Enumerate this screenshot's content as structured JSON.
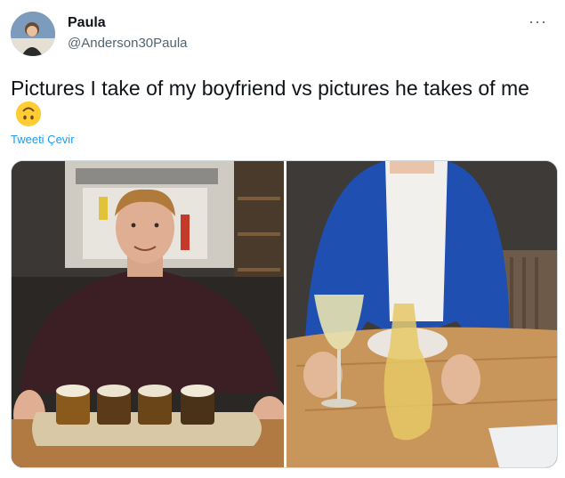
{
  "author": {
    "name": "Paula",
    "handle": "@Anderson30Paula"
  },
  "tweet": {
    "text": "Pictures I take of my boyfriend vs pictures he takes of me",
    "emoji_icon": "upside-down-face-emoji",
    "translate_label": "Tweeti Çevir"
  },
  "menu": {
    "more_label": "···"
  },
  "media": {
    "left_image": "man-with-beer-flight",
    "right_image": "woman-in-blue-blazer-with-wine"
  }
}
